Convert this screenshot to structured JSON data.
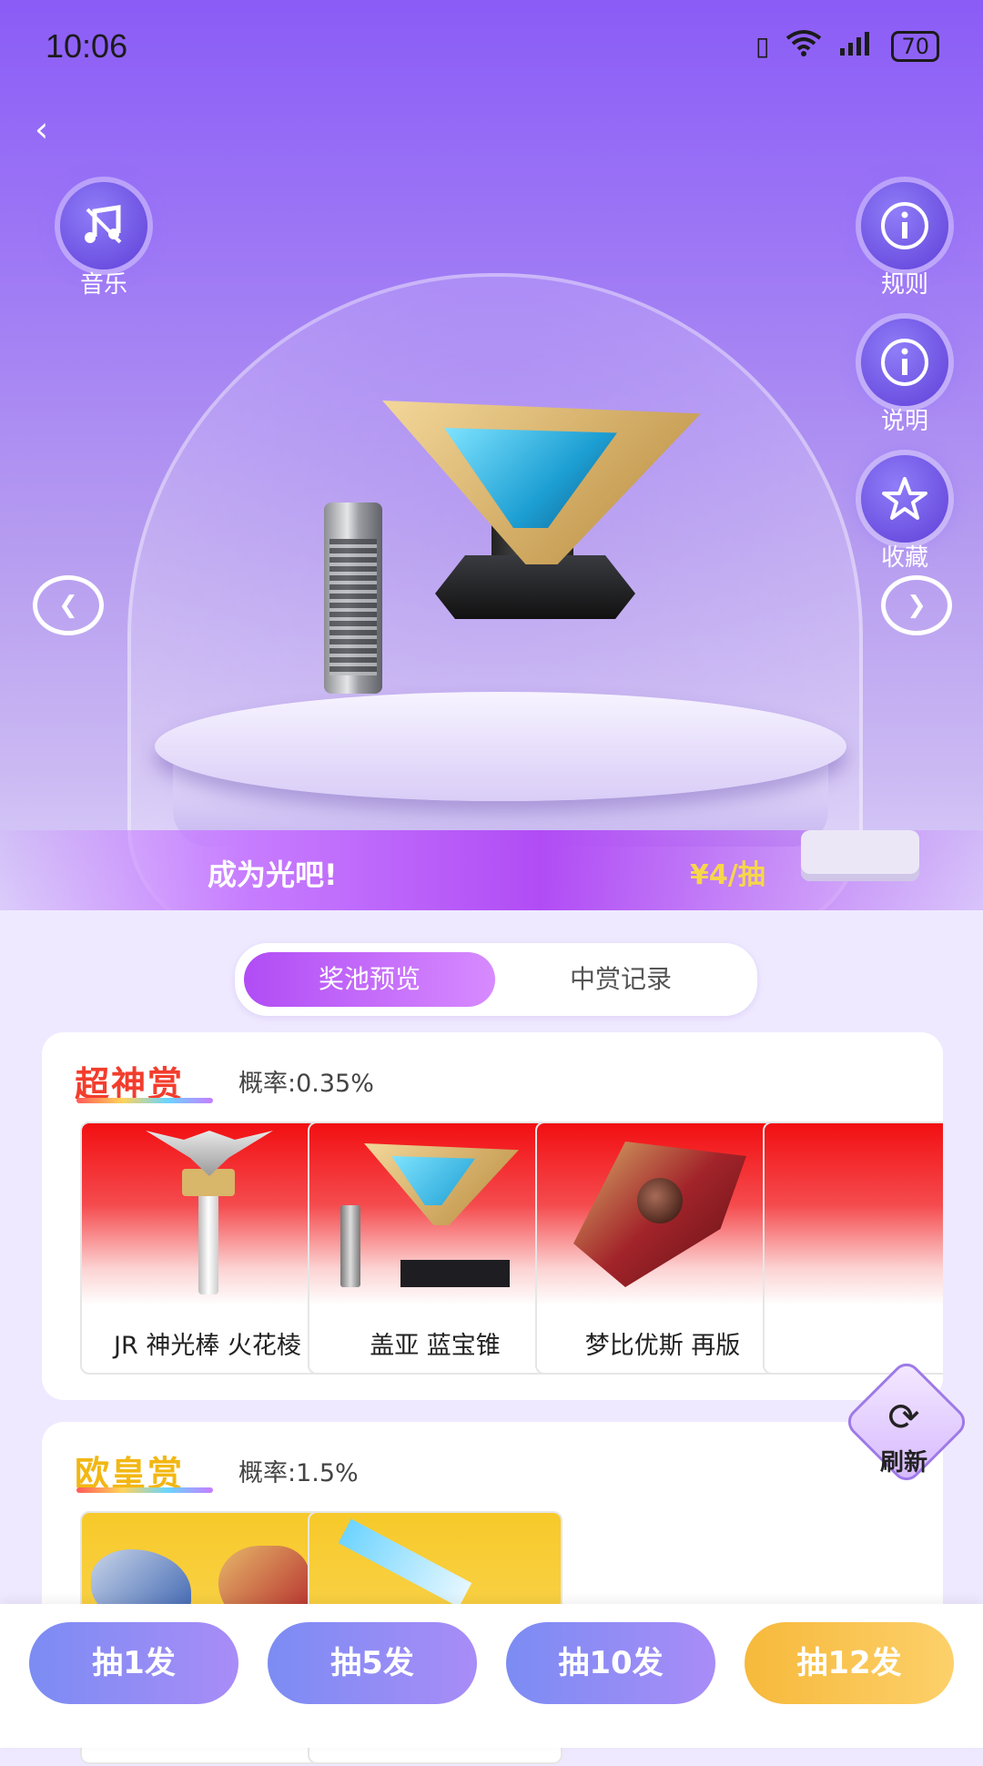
{
  "status": {
    "time": "10:06",
    "battery": "70"
  },
  "top_actions": {
    "music": "音乐",
    "rules": "规则",
    "explain": "说明",
    "favorite": "收藏"
  },
  "banner": {
    "title": "成为光吧!",
    "price": "¥4/抽"
  },
  "tabs": [
    {
      "label": "奖池预览",
      "active": true
    },
    {
      "label": "中赏记录",
      "active": false
    }
  ],
  "sections": [
    {
      "title": "超神赏",
      "rate": "概率:0.35%",
      "items": [
        {
          "name": "JR 神光棒 火花棱"
        },
        {
          "name": "盖亚 蓝宝锥"
        },
        {
          "name": "梦比优斯 再版"
        }
      ]
    },
    {
      "title": "欧皇赏",
      "rate": "概率:1.5%"
    }
  ],
  "refresh": {
    "label": "刷新"
  },
  "draw_buttons": [
    {
      "label": "抽1发"
    },
    {
      "label": "抽5发"
    },
    {
      "label": "抽10发"
    },
    {
      "label": "抽12发"
    }
  ],
  "colors": {
    "accent": "#b14cf5",
    "price": "#f7d64a",
    "gold_button": "#f6b93b"
  }
}
